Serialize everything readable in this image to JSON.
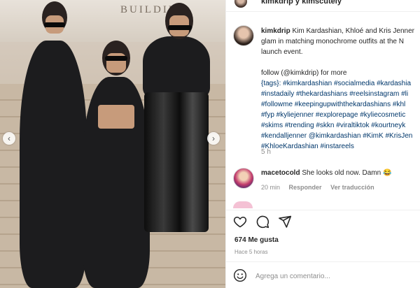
{
  "photo": {
    "sign_text": "BUILDIN",
    "prev_glyph": "‹",
    "next_glyph": "›"
  },
  "header": {
    "names": "kimkdrip y kimscutely"
  },
  "caption": {
    "username": "kimkdrip",
    "lines": [
      "Kim Kardashian, Khloé and Kris Jenner",
      "glam in matching monochrome outfits at the N",
      "launch event.",
      "",
      "follow (@kimkdrip) for more",
      "{tags}: #kimkardashian #socialmedia #kardashia",
      "#instadaily #thekardashians #reelsinstagram #li",
      "#followme #keepingupwiththekardashians #khl",
      "#fyp #kyliejenner #explorepage #kyliecosmetic",
      "#skims #trending #skkn #viraltiktok #kourtneyk",
      "#kendalljenner @kimkardashian #KimK #KrisJen",
      "#KhloeKardashian #instareels"
    ],
    "time": "5 h"
  },
  "comment": {
    "username": "macetocold",
    "text": "She looks old now. Damn 😂",
    "time": "20 min",
    "reply": "Responder",
    "translate": "Ver traducción"
  },
  "stats": {
    "likes": "674 Me gusta",
    "ago": "Hace 5 horas"
  },
  "add_comment": {
    "placeholder": "Agrega un comentario..."
  },
  "colors": {
    "link": "#00376b",
    "muted": "#8e8e8e",
    "text": "#262626"
  },
  "icons": [
    "heart-icon",
    "comment-icon",
    "share-icon",
    "emoji-icon",
    "chevron-left-icon",
    "chevron-right-icon"
  ]
}
